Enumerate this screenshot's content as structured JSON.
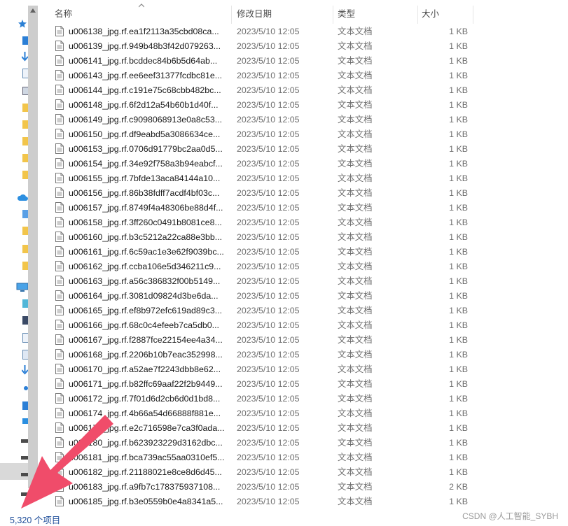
{
  "header": {
    "name": "名称",
    "date_modified": "修改日期",
    "type": "类型",
    "size": "大小"
  },
  "rows": [
    {
      "name": "u006138_jpg.rf.ea1f2113a35cbd08ca...",
      "date": "2023/5/10 12:05",
      "type": "文本文档",
      "size": "1 KB"
    },
    {
      "name": "u006139_jpg.rf.949b48b3f42d079263...",
      "date": "2023/5/10 12:05",
      "type": "文本文档",
      "size": "1 KB"
    },
    {
      "name": "u006141_jpg.rf.bcddec84b6b5d64ab...",
      "date": "2023/5/10 12:05",
      "type": "文本文档",
      "size": "1 KB"
    },
    {
      "name": "u006143_jpg.rf.ee6eef31377fcdbc81e...",
      "date": "2023/5/10 12:05",
      "type": "文本文档",
      "size": "1 KB"
    },
    {
      "name": "u006144_jpg.rf.c191e75c68cbb482bc...",
      "date": "2023/5/10 12:05",
      "type": "文本文档",
      "size": "1 KB"
    },
    {
      "name": "u006148_jpg.rf.6f2d12a54b60b1d40f...",
      "date": "2023/5/10 12:05",
      "type": "文本文档",
      "size": "1 KB"
    },
    {
      "name": "u006149_jpg.rf.c9098068913e0a8c53...",
      "date": "2023/5/10 12:05",
      "type": "文本文档",
      "size": "1 KB"
    },
    {
      "name": "u006150_jpg.rf.df9eabd5a3086634ce...",
      "date": "2023/5/10 12:05",
      "type": "文本文档",
      "size": "1 KB"
    },
    {
      "name": "u006153_jpg.rf.0706d91779bc2aa0d5...",
      "date": "2023/5/10 12:05",
      "type": "文本文档",
      "size": "1 KB"
    },
    {
      "name": "u006154_jpg.rf.34e92f758a3b94eabcf...",
      "date": "2023/5/10 12:05",
      "type": "文本文档",
      "size": "1 KB"
    },
    {
      "name": "u006155_jpg.rf.7bfde13aca84144a10...",
      "date": "2023/5/10 12:05",
      "type": "文本文档",
      "size": "1 KB"
    },
    {
      "name": "u006156_jpg.rf.86b38fdff7acdf4bf03c...",
      "date": "2023/5/10 12:05",
      "type": "文本文档",
      "size": "1 KB"
    },
    {
      "name": "u006157_jpg.rf.8749f4a48306be88d4f...",
      "date": "2023/5/10 12:05",
      "type": "文本文档",
      "size": "1 KB"
    },
    {
      "name": "u006158_jpg.rf.3ff260c0491b8081ce8...",
      "date": "2023/5/10 12:05",
      "type": "文本文档",
      "size": "1 KB"
    },
    {
      "name": "u006160_jpg.rf.b3c5212a22ca88e3bb...",
      "date": "2023/5/10 12:05",
      "type": "文本文档",
      "size": "1 KB"
    },
    {
      "name": "u006161_jpg.rf.6c59ac1e3e62f9039bc...",
      "date": "2023/5/10 12:05",
      "type": "文本文档",
      "size": "1 KB"
    },
    {
      "name": "u006162_jpg.rf.ccba106e5d346211c9...",
      "date": "2023/5/10 12:05",
      "type": "文本文档",
      "size": "1 KB"
    },
    {
      "name": "u006163_jpg.rf.a56c386832f00b5149...",
      "date": "2023/5/10 12:05",
      "type": "文本文档",
      "size": "1 KB"
    },
    {
      "name": "u006164_jpg.rf.3081d09824d3be6da...",
      "date": "2023/5/10 12:05",
      "type": "文本文档",
      "size": "1 KB"
    },
    {
      "name": "u006165_jpg.rf.ef8b972efc619ad89c3...",
      "date": "2023/5/10 12:05",
      "type": "文本文档",
      "size": "1 KB"
    },
    {
      "name": "u006166_jpg.rf.68c0c4efeeb7ca5db0...",
      "date": "2023/5/10 12:05",
      "type": "文本文档",
      "size": "1 KB"
    },
    {
      "name": "u006167_jpg.rf.f2887fce22154ee4a34...",
      "date": "2023/5/10 12:05",
      "type": "文本文档",
      "size": "1 KB"
    },
    {
      "name": "u006168_jpg.rf.2206b10b7eac352998...",
      "date": "2023/5/10 12:05",
      "type": "文本文档",
      "size": "1 KB"
    },
    {
      "name": "u006170_jpg.rf.a52ae7f2243dbb8e62...",
      "date": "2023/5/10 12:05",
      "type": "文本文档",
      "size": "1 KB"
    },
    {
      "name": "u006171_jpg.rf.b82ffc69aaf22f2b9449...",
      "date": "2023/5/10 12:05",
      "type": "文本文档",
      "size": "1 KB"
    },
    {
      "name": "u006172_jpg.rf.7f01d6d2cb6d0d1bd8...",
      "date": "2023/5/10 12:05",
      "type": "文本文档",
      "size": "1 KB"
    },
    {
      "name": "u006174_jpg.rf.4b66a54d66888f881e...",
      "date": "2023/5/10 12:05",
      "type": "文本文档",
      "size": "1 KB"
    },
    {
      "name": "u006177_jpg.rf.e2c716598e7ca3f0ada...",
      "date": "2023/5/10 12:05",
      "type": "文本文档",
      "size": "1 KB"
    },
    {
      "name": "u006180_jpg.rf.b623923229d3162dbc...",
      "date": "2023/5/10 12:05",
      "type": "文本文档",
      "size": "1 KB"
    },
    {
      "name": "u006181_jpg.rf.bca739ac55aa0310ef5...",
      "date": "2023/5/10 12:05",
      "type": "文本文档",
      "size": "1 KB"
    },
    {
      "name": "u006182_jpg.rf.21188021e8ce8d6d45...",
      "date": "2023/5/10 12:05",
      "type": "文本文档",
      "size": "1 KB"
    },
    {
      "name": "u006183_jpg.rf.a9fb7c178375937108...",
      "date": "2023/5/10 12:05",
      "type": "文本文档",
      "size": "2 KB"
    },
    {
      "name": "u006185_jpg.rf.b3e0559b0e4a8341a5...",
      "date": "2023/5/10 12:05",
      "type": "文本文档",
      "size": "1 KB"
    }
  ],
  "status": {
    "item_count": "5,320 个项目"
  },
  "watermark": "CSDN @人工智能_SYBH",
  "colors": {
    "arrow": "#f04c6a",
    "status_text": "#1f4e9a"
  }
}
